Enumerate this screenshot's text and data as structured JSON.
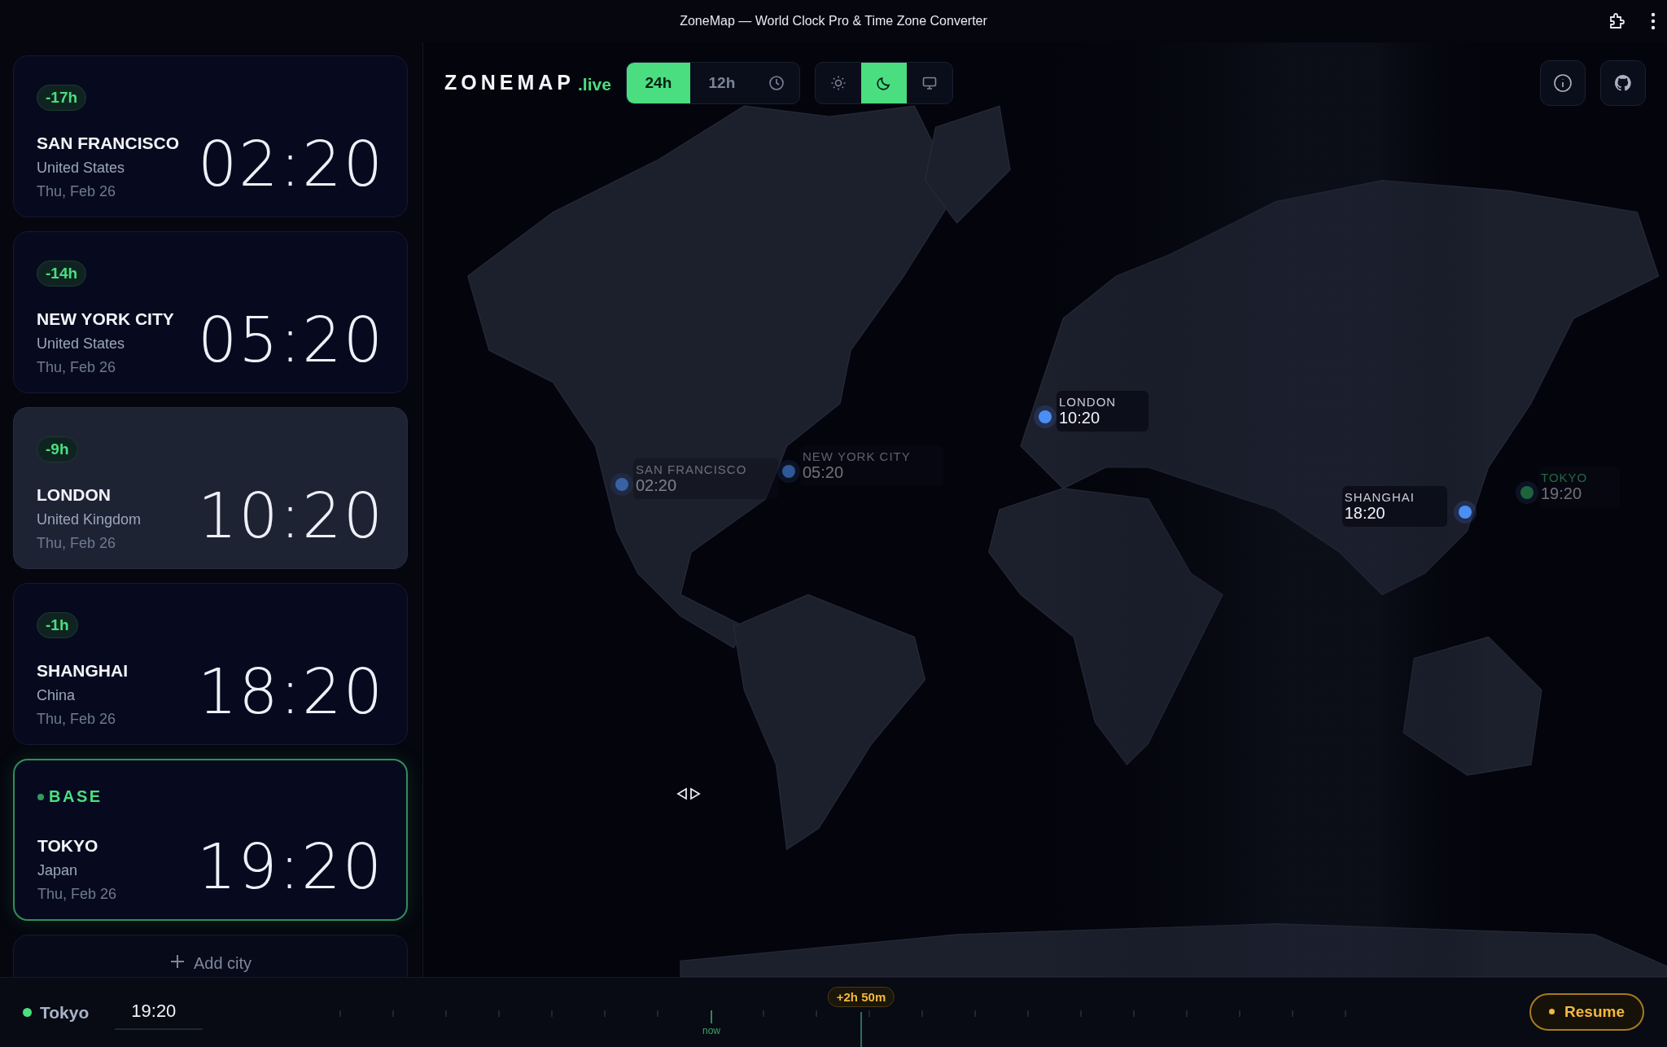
{
  "window": {
    "title": "ZoneMap — World Clock Pro & Time Zone Converter"
  },
  "cities": [
    {
      "kind": "offset",
      "badge": "-17h",
      "name": "SAN FRANCISCO",
      "country": "United States",
      "date": "Thu, Feb 26",
      "time": "02:20",
      "selected": false
    },
    {
      "kind": "offset",
      "badge": "-14h",
      "name": "NEW YORK CITY",
      "country": "United States",
      "date": "Thu, Feb 26",
      "time": "05:20",
      "selected": false
    },
    {
      "kind": "offset",
      "badge": "-9h",
      "name": "LONDON",
      "country": "United Kingdom",
      "date": "Thu, Feb 26",
      "time": "10:20",
      "selected": true
    },
    {
      "kind": "offset",
      "badge": "-1h",
      "name": "SHANGHAI",
      "country": "China",
      "date": "Thu, Feb 26",
      "time": "18:20",
      "selected": false
    },
    {
      "kind": "base",
      "badge": "BASE",
      "name": "TOKYO",
      "country": "Japan",
      "date": "Thu, Feb 26",
      "time": "19:20",
      "selected": false
    }
  ],
  "add_city": "Add city",
  "header": {
    "logo": "ZONEMAP",
    "logo_suffix": ".live",
    "format_toggle": [
      {
        "kind": "text",
        "label": "24h",
        "selected": true
      },
      {
        "kind": "text",
        "label": "12h",
        "selected": false
      },
      {
        "kind": "clock",
        "selected": false
      }
    ],
    "theme_toggle": [
      {
        "kind": "sun",
        "selected": false
      },
      {
        "kind": "moon",
        "selected": true
      },
      {
        "kind": "monitor",
        "selected": false
      }
    ]
  },
  "map": {
    "pins": [
      {
        "kind": "city",
        "name": "SAN FRANCISCO",
        "time": "02:20",
        "dimmed": true
      },
      {
        "kind": "city",
        "name": "NEW YORK CITY",
        "time": "05:20",
        "dimmed": true
      },
      {
        "kind": "city",
        "name": "LONDON",
        "time": "10:20",
        "dimmed": false
      },
      {
        "kind": "city",
        "name": "SHANGHAI",
        "time": "18:20",
        "dimmed": false
      },
      {
        "kind": "base",
        "name": "TOKYO",
        "time": "19:20",
        "dimmed": true
      }
    ]
  },
  "timeline": {
    "base_city": "Tokyo",
    "time_value": "19:20",
    "now_label": "now",
    "offset_badge": "+2h 50m",
    "resume": "Resume"
  }
}
